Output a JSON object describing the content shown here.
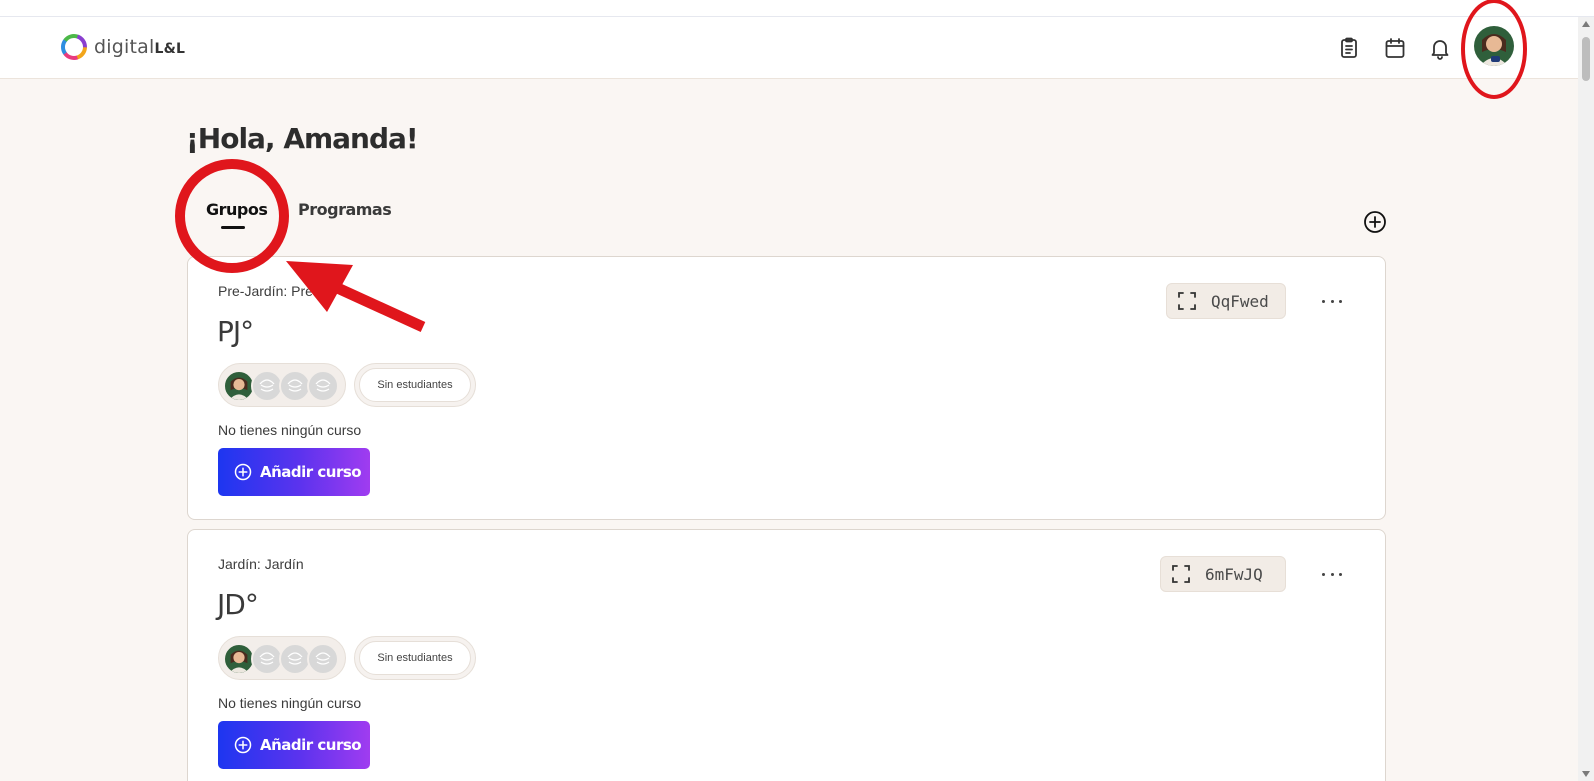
{
  "brand": {
    "name": "digital",
    "suffix": "L&L"
  },
  "header": {
    "icons": [
      "clipboard-icon",
      "calendar-icon",
      "bell-icon"
    ],
    "user_avatar": "user-avatar"
  },
  "greeting": "¡Hola, Amanda!",
  "tabs": [
    {
      "label": "Grupos",
      "active": true
    },
    {
      "label": "Programas",
      "active": false
    }
  ],
  "groups": [
    {
      "subtitle": "Pre-Jardín: Pre-",
      "title": "PJ°",
      "students_label": "Sin estudiantes",
      "empty_text": "No tienes ningún curso",
      "add_label": "Añadir curso",
      "code": "QqFwed"
    },
    {
      "subtitle": "Jardín: Jardín",
      "title": "JD°",
      "students_label": "Sin estudiantes",
      "empty_text": "No tienes ningún curso",
      "add_label": "Añadir curso",
      "code": "6mFwJQ"
    }
  ],
  "colors": {
    "accent_start": "#1d36f0",
    "accent_end": "#a03cf0",
    "annotation": "#e0161c",
    "background": "#faf6f3"
  }
}
